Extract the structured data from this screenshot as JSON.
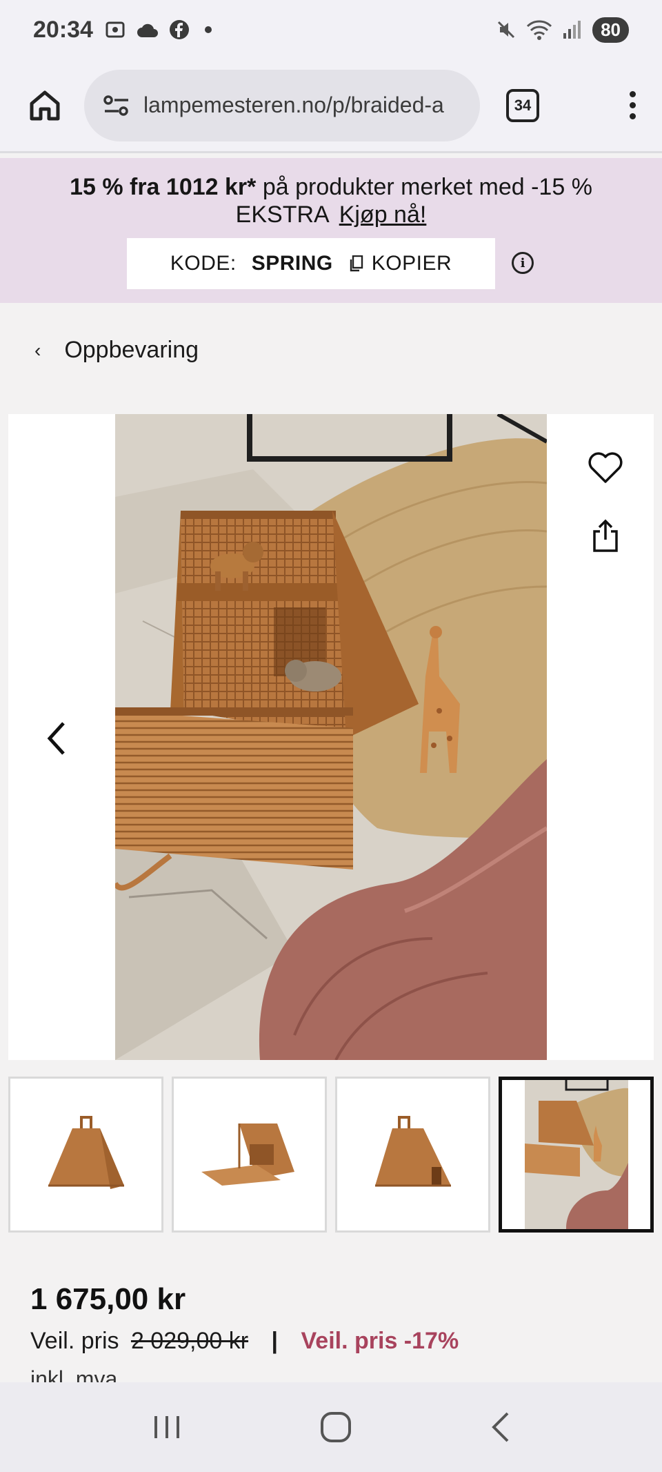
{
  "status_bar": {
    "time": "20:34",
    "battery": "80"
  },
  "browser": {
    "url": "lampemesteren.no/p/braided-a",
    "tab_count": "34"
  },
  "promo": {
    "headline_bold": "15 % fra 1012 kr*",
    "headline_rest": " på produkter merket med -15 % EKSTRA",
    "cta": "Kjøp nå!",
    "code_label": "KODE:",
    "code_value": "SPRING",
    "copy_label": "KOPIER"
  },
  "breadcrumb": {
    "label": "Oppbevaring"
  },
  "product": {
    "price": "1 675,00 kr",
    "rrp_label": "Veil. pris",
    "rrp_value": "2 029,00 kr",
    "separator": "|",
    "discount_label": "Veil. pris -17%",
    "vat_note": "inkl. mva"
  },
  "gallery": {
    "thumbnail_count": 4,
    "active_thumbnail": 4
  },
  "colors": {
    "promo_bg": "#e8dbe9",
    "discount": "#a8435d",
    "wicker": "#b8773f"
  }
}
